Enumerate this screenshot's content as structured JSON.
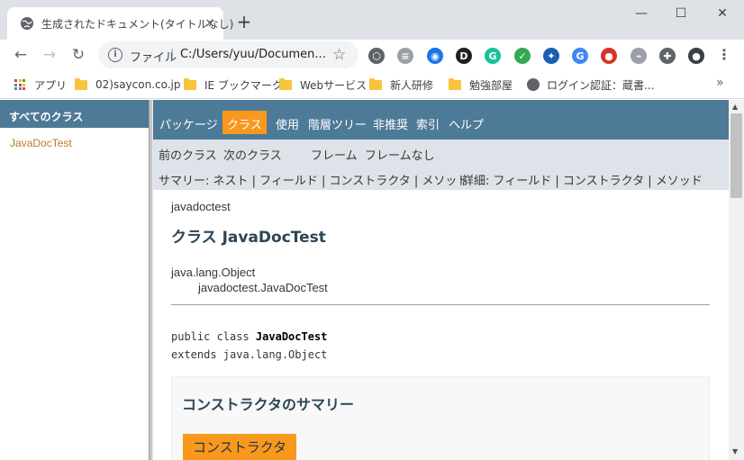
{
  "browser": {
    "tab_title": "生成されたドキュメント(タイトルなし)",
    "tab_close": "✕",
    "new_tab": "+",
    "window_controls": [
      "—",
      "☐",
      "✕"
    ],
    "omnibox": {
      "label": "ファイル",
      "separator": "|",
      "url": "C:/Users/yuu/Documen..."
    },
    "bookmarks": [
      {
        "label": "アプリ",
        "icon": "apps-grid-icon"
      },
      {
        "label": "02)saycon.co.jp",
        "icon": "folder-icon"
      },
      {
        "label": "IE ブックマーク",
        "icon": "folder-icon"
      },
      {
        "label": "Webサービス",
        "icon": "folder-icon"
      },
      {
        "label": "新人研修",
        "icon": "folder-icon"
      },
      {
        "label": "勉強部屋",
        "icon": "folder-icon"
      },
      {
        "label": "ログイン認証：蔵書...",
        "icon": "globe-icon"
      }
    ],
    "bookmarks_more": "»",
    "extensions": [
      {
        "name": "cube-extension-icon",
        "glyph": "⬡",
        "color": "#5f6368"
      },
      {
        "name": "notes-extension-icon",
        "glyph": "≡",
        "color": "#9aa0a6"
      },
      {
        "name": "compass-extension-icon",
        "glyph": "◉",
        "color": "#1a73e8"
      },
      {
        "name": "dictionary-extension-icon",
        "glyph": "D",
        "color": "#202124"
      },
      {
        "name": "grammarly-extension-icon",
        "glyph": "G",
        "color": "#15c39a"
      },
      {
        "name": "shield-extension-icon",
        "glyph": "✓",
        "color": "#34a853"
      },
      {
        "name": "network-extension-icon",
        "glyph": "✦",
        "color": "#1a5fb4"
      },
      {
        "name": "translate-extension-icon",
        "glyph": "G",
        "color": "#4285f4"
      },
      {
        "name": "red-extension-icon",
        "glyph": "●",
        "color": "#d93025"
      },
      {
        "name": "pdf-extension-icon",
        "glyph": "⌁",
        "color": "#9aa0a6"
      },
      {
        "name": "puzzle-extension-icon",
        "glyph": "✚",
        "color": "#5f6368"
      },
      {
        "name": "profile-avatar-icon",
        "glyph": "●",
        "color": "#3c4043"
      }
    ]
  },
  "sidebar": {
    "header": "すべてのクラス",
    "classes": [
      "JavaDocTest"
    ]
  },
  "navbar": {
    "items": [
      "パッケージ",
      "クラス",
      "使用",
      "階層ツリー",
      "非推奨",
      "索引",
      "ヘルプ"
    ],
    "active": "クラス"
  },
  "subnav": {
    "prev_class": "前のクラス",
    "next_class": "次のクラス",
    "frames": "フレーム",
    "no_frames": "フレームなし",
    "summary_line": "サマリー: ネスト | フィールド | コンストラクタ | メソッド",
    "detail_line": "詳細: フィールド | コンストラクタ | メソッド"
  },
  "doc": {
    "package": "javadoctest",
    "title": "クラス JavaDocTest",
    "inheritance": [
      "java.lang.Object",
      "javadoctest.JavaDocTest"
    ],
    "signature_prefix": "public class ",
    "signature_name": "JavaDocTest",
    "extends_line": "extends java.lang.Object",
    "summary_heading": "コンストラクタのサマリー",
    "summary_tab": "コンストラクタ"
  },
  "colors": {
    "javadoc_nav": "#4d7a97",
    "javadoc_active": "#f8981d",
    "subnav_bg": "#dee3e9",
    "chrome_tabstrip": "#dee1e6"
  }
}
